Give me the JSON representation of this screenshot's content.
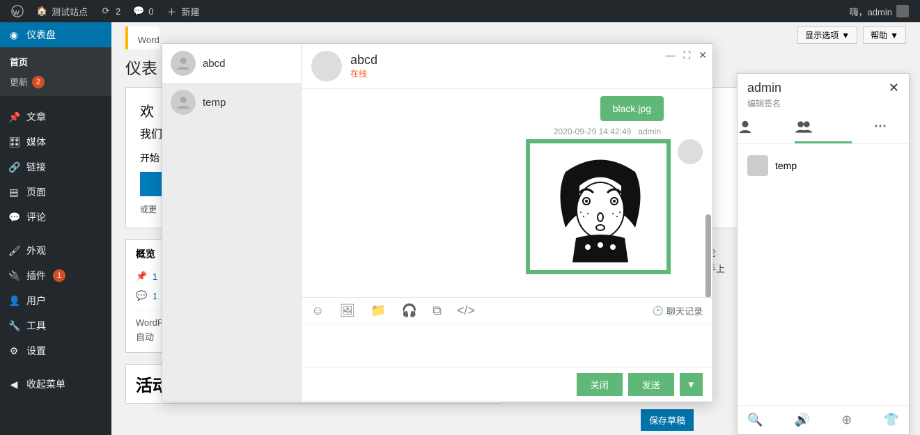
{
  "adminbar": {
    "site_name": "测试站点",
    "updates": "2",
    "comments": "0",
    "new": "新建",
    "howdy": "嗨，admin"
  },
  "sidebar": {
    "dashboard": "仪表盘",
    "home": "首页",
    "updates": "更新",
    "updates_badge": "2",
    "posts": "文章",
    "media": "媒体",
    "links": "链接",
    "pages": "页面",
    "comments": "评论",
    "appearance": "外观",
    "plugins": "插件",
    "plugins_badge": "1",
    "users": "用户",
    "tools": "工具",
    "settings": "设置",
    "collapse": "收起菜单"
  },
  "main": {
    "screen_options": "显示选项",
    "help": "帮助",
    "notice_prefix": "Word",
    "title": "仪表",
    "welcome_h": "欢",
    "welcome_sub": "我们",
    "start": "开始",
    "or": "或更",
    "overview_h": "概览",
    "pin_count": "1",
    "comment_count": "1",
    "wp_ver_line1": "WordP",
    "wp_ver_line2": "自动",
    "activity_h": "活动",
    "side_text1": "论",
    "side_text2": "手上",
    "save_draft": "保存草稿"
  },
  "chat": {
    "contacts": [
      {
        "name": "abcd"
      },
      {
        "name": "temp"
      }
    ],
    "header_name": "abcd",
    "header_status": "在线",
    "file_name": "black.jpg",
    "msg_time": "2020-09-29 14:42:49",
    "msg_sender": "admin",
    "history": "聊天记录",
    "close": "关闭",
    "send": "发送"
  },
  "im": {
    "username": "admin",
    "signature": "编辑签名",
    "friend": "temp"
  }
}
